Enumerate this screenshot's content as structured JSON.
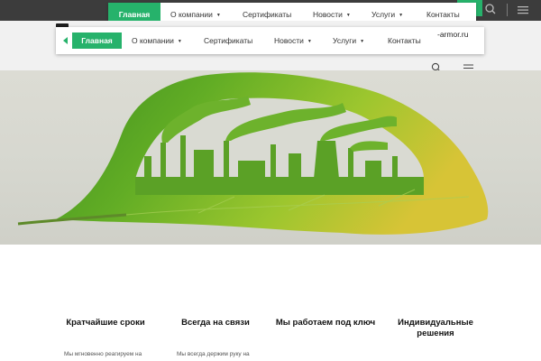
{
  "topbar": {
    "search_icon": "search-icon",
    "menu_icon": "menu-icon",
    "accent": "#26b26b"
  },
  "nav": {
    "items": [
      {
        "label": "Главная",
        "active": true
      },
      {
        "label": "О компании",
        "has_dropdown": true
      },
      {
        "label": "Сертификаты"
      },
      {
        "label": "Новости",
        "has_dropdown": true
      },
      {
        "label": "Услуги",
        "has_dropdown": true
      },
      {
        "label": "Контакты"
      }
    ]
  },
  "header": {
    "site_text": "-armor.ru",
    "search_icon": "search-icon",
    "menu_icon": "menu-icon"
  },
  "hero": {
    "image": "green leaf with cut-out factory skyline"
  },
  "features": [
    {
      "title": "Кратчайшие сроки",
      "text": "Мы мгновенно реагируем на"
    },
    {
      "title": "Всегда на связи",
      "text": "Мы всегда держим руку на"
    },
    {
      "title": "Мы работаем под ключ",
      "text": ""
    },
    {
      "title": "Индивидуальные решения",
      "text": ""
    }
  ]
}
